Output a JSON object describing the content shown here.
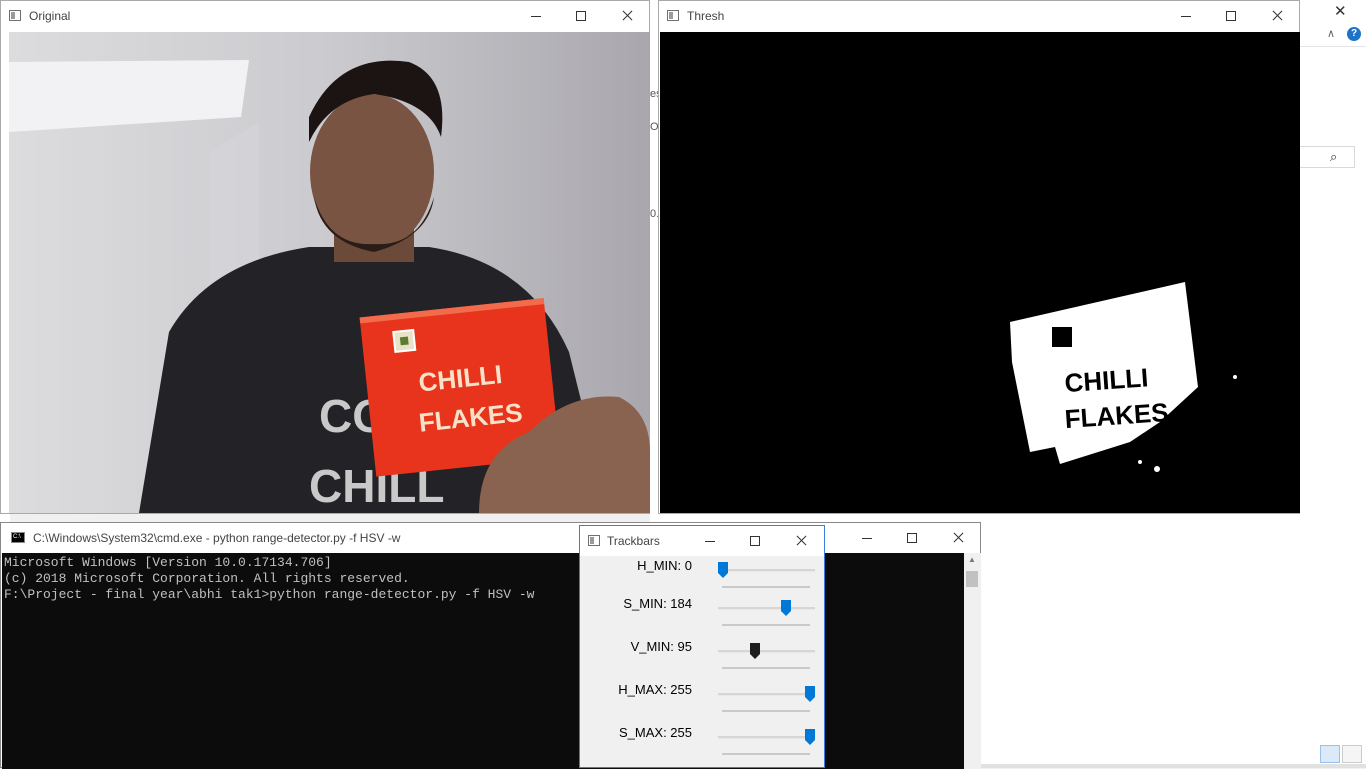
{
  "windows": {
    "original": {
      "title": "Original"
    },
    "thresh": {
      "title": "Thresh"
    },
    "cmd": {
      "title": "C:\\Windows\\System32\\cmd.exe - python  range-detector.py -f HSV -w",
      "icon_text": "C:\\",
      "lines": [
        "Microsoft Windows [Version 10.0.17134.706]",
        "(c) 2018 Microsoft Corporation. All rights reserved.",
        "",
        "F:\\Project - final year\\abhi tak1>python range-detector.py -f HSV -w"
      ]
    },
    "trackbars": {
      "title": "Trackbars",
      "items": [
        {
          "label": "H_MIN: 0",
          "value": 0,
          "max": 255,
          "color": "#0078d7"
        },
        {
          "label": "S_MIN: 184",
          "value": 184,
          "max": 255,
          "color": "#0078d7"
        },
        {
          "label": "V_MIN: 95",
          "value": 95,
          "max": 255,
          "color": "#1e1e1e"
        },
        {
          "label": "H_MAX: 255",
          "value": 255,
          "max": 255,
          "color": "#0078d7"
        },
        {
          "label": "S_MAX: 255",
          "value": 255,
          "max": 255,
          "color": "#0078d7"
        }
      ]
    }
  },
  "packet_text": {
    "line1": "CHILLI",
    "line2": "FLAKES"
  },
  "shirt_text": {
    "line1": "CO",
    "line2": "CHILL"
  },
  "background_peek": [
    "es",
    "O",
    "0.."
  ],
  "icons": {
    "window_controls": [
      "minimize-icon",
      "maximize-icon",
      "close-icon"
    ],
    "background": [
      "search-icon",
      "help-icon",
      "chevron-up-icon",
      "close-icon",
      "details-view-icon",
      "large-icons-view-icon"
    ]
  },
  "colors": {
    "accent": "#0078d7",
    "packet": "#e8341c",
    "console_bg": "#0c0c0c"
  }
}
